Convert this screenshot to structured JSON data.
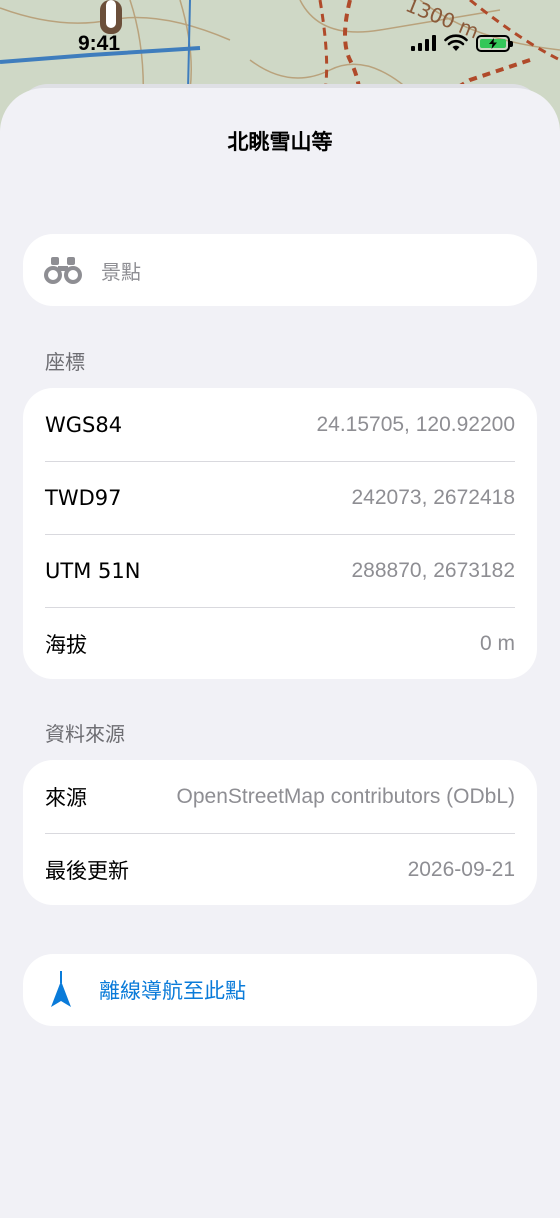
{
  "status_bar": {
    "time": "9:41"
  },
  "map": {
    "contour_label": "1300 m"
  },
  "sheet": {
    "title": "北眺雪山等",
    "category": {
      "icon": "binoculars-icon",
      "label": "景點"
    },
    "coordinates": {
      "header": "座標",
      "rows": [
        {
          "key": "WGS84",
          "value": "24.15705, 120.92200"
        },
        {
          "key": "TWD97",
          "value": "242073, 2672418"
        },
        {
          "key": "UTM 51N",
          "value": "288870, 2673182"
        },
        {
          "key": "海拔",
          "value": "0 m"
        }
      ]
    },
    "data_source": {
      "header": "資料來源",
      "rows": [
        {
          "key": "來源",
          "value": "OpenStreetMap contributors (ODbL)"
        },
        {
          "key": "最後更新",
          "value": "2026-09-21"
        }
      ]
    },
    "navigate": {
      "icon": "navigation-arrow-icon",
      "label": "離線導航至此點"
    }
  },
  "colors": {
    "accent": "#0a7bd9",
    "battery": "#34c759",
    "background": "#f1f1f6",
    "secondary_text": "#8e8e93"
  }
}
